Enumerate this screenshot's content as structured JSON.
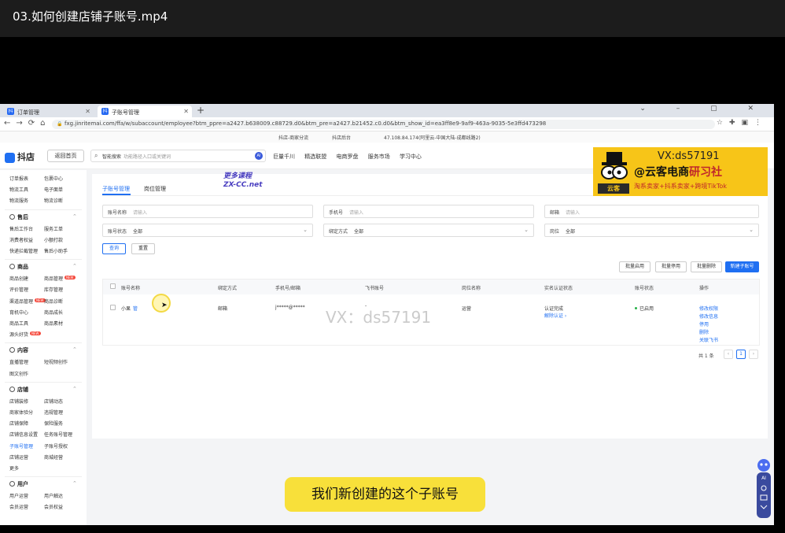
{
  "video_title": "03.如何创建店铺子账号.mp4",
  "browser": {
    "tabs": [
      {
        "label": "订单管理"
      },
      {
        "label": "子账号管理"
      }
    ],
    "url": "fxg.jinritemai.com/ffa/w/subaccount/employee?btm_ppre=a2427.b638009.c88729.d0&btm_pre=a2427.b21452.c0.d0&btm_show_id=ea3ff8e9-9af9-463a-9035-5e3ffd473298",
    "info_items": [
      "抖店-商家分流",
      "抖店后台",
      "47.108.84.174(阿里云-中国大陆-成都线路2)"
    ]
  },
  "header": {
    "logo": "抖店",
    "home_button": "返回首页",
    "search_label": "智能搜索",
    "search_placeholder": "功能路径入口或关键词",
    "search_ai": "AI",
    "nav": [
      "巨量千川",
      "精选联盟",
      "电商罗盘",
      "服务市场",
      "学习中心"
    ]
  },
  "sidebar": {
    "top_rows": [
      [
        "订单报表",
        "包裹中心"
      ],
      [
        "物流工具",
        "电子面单"
      ],
      [
        "物流服务",
        "物流诊断"
      ]
    ],
    "sections": [
      {
        "title": "售后",
        "rows": [
          [
            "售后工作台",
            "服务工单"
          ],
          [
            "消费者权益",
            "小额打款"
          ],
          [
            "快递拦截管理",
            "售后小助手"
          ]
        ]
      },
      {
        "title": "商品",
        "rows": [
          [
            "商品创建",
            "商品管理"
          ],
          [
            "评价管理",
            "库存管理"
          ],
          [
            "渠道品管理",
            "商品诊断"
          ],
          [
            "育机中心",
            "商品成长"
          ],
          [
            "商品工具",
            "商品素材"
          ],
          [
            "源头好货",
            ""
          ]
        ]
      },
      {
        "title": "内容",
        "rows": [
          [
            "直播管理",
            "短视频创作"
          ],
          [
            "图文创作",
            ""
          ]
        ]
      },
      {
        "title": "店铺",
        "rows": [
          [
            "店铺装修",
            "店铺动态"
          ],
          [
            "商家体验分",
            "违规管理"
          ],
          [
            "店铺保障",
            "保险服务"
          ],
          [
            "店铺信息设置",
            "任务账号管理"
          ],
          [
            "子账号管理",
            "子账号授权"
          ],
          [
            "店铺运营",
            "商城经营"
          ],
          [
            "更多",
            ""
          ]
        ]
      },
      {
        "title": "用户",
        "rows": [
          [
            "用户运营",
            "用户触达"
          ],
          [
            "会员运营",
            "会员权益"
          ]
        ]
      }
    ],
    "badge_new": "NEW"
  },
  "main": {
    "tabs": [
      "子账号管理",
      "岗位管理"
    ],
    "filters": {
      "account_name_label": "账号名称",
      "account_name_ph": "请输入",
      "phone_label": "手机号",
      "phone_ph": "请输入",
      "email_label": "邮箱",
      "email_ph": "请输入",
      "account_status_label": "账号状态",
      "account_status_val": "全部",
      "bind_method_label": "绑定方式",
      "bind_method_val": "全部",
      "position_label": "岗位",
      "position_val": "全部"
    },
    "query_button": "查询",
    "reset_button": "重置",
    "batch_enable": "批量启用",
    "batch_disable": "批量停用",
    "batch_delete": "批量删除",
    "new_subaccount": "新建子账号",
    "columns": [
      "账号名称",
      "绑定方式",
      "手机号/邮箱",
      "飞书账号",
      "岗位名称",
      "实名认证状态",
      "账号状态",
      "操作"
    ],
    "row": {
      "name": "小果",
      "name_tag": "管",
      "bind": "邮箱",
      "contact": "j*****@*****",
      "feishu": "-",
      "position": "运营",
      "verify_status": "认证完成",
      "verify_action": "解除认证",
      "account_status": "已启用",
      "actions": [
        "修改权限",
        "修改信息",
        "停用",
        "删除",
        "关联飞书"
      ]
    },
    "total": "共 1 条",
    "page": "1"
  },
  "overlay": {
    "watermark_center": "VX：ds57191",
    "watermark_top_1": "更多课程",
    "watermark_top_2": "ZX-CC.net",
    "banner_vx": "VX:ds57191",
    "banner_name": "@云客电商",
    "banner_name_red": "研习社",
    "banner_tag": "淘系卖家+抖系卖家+跨境TikTok",
    "banner_logo": "云客",
    "subtitle": "我们新创建的这个子账号",
    "float_ai": "AI"
  }
}
